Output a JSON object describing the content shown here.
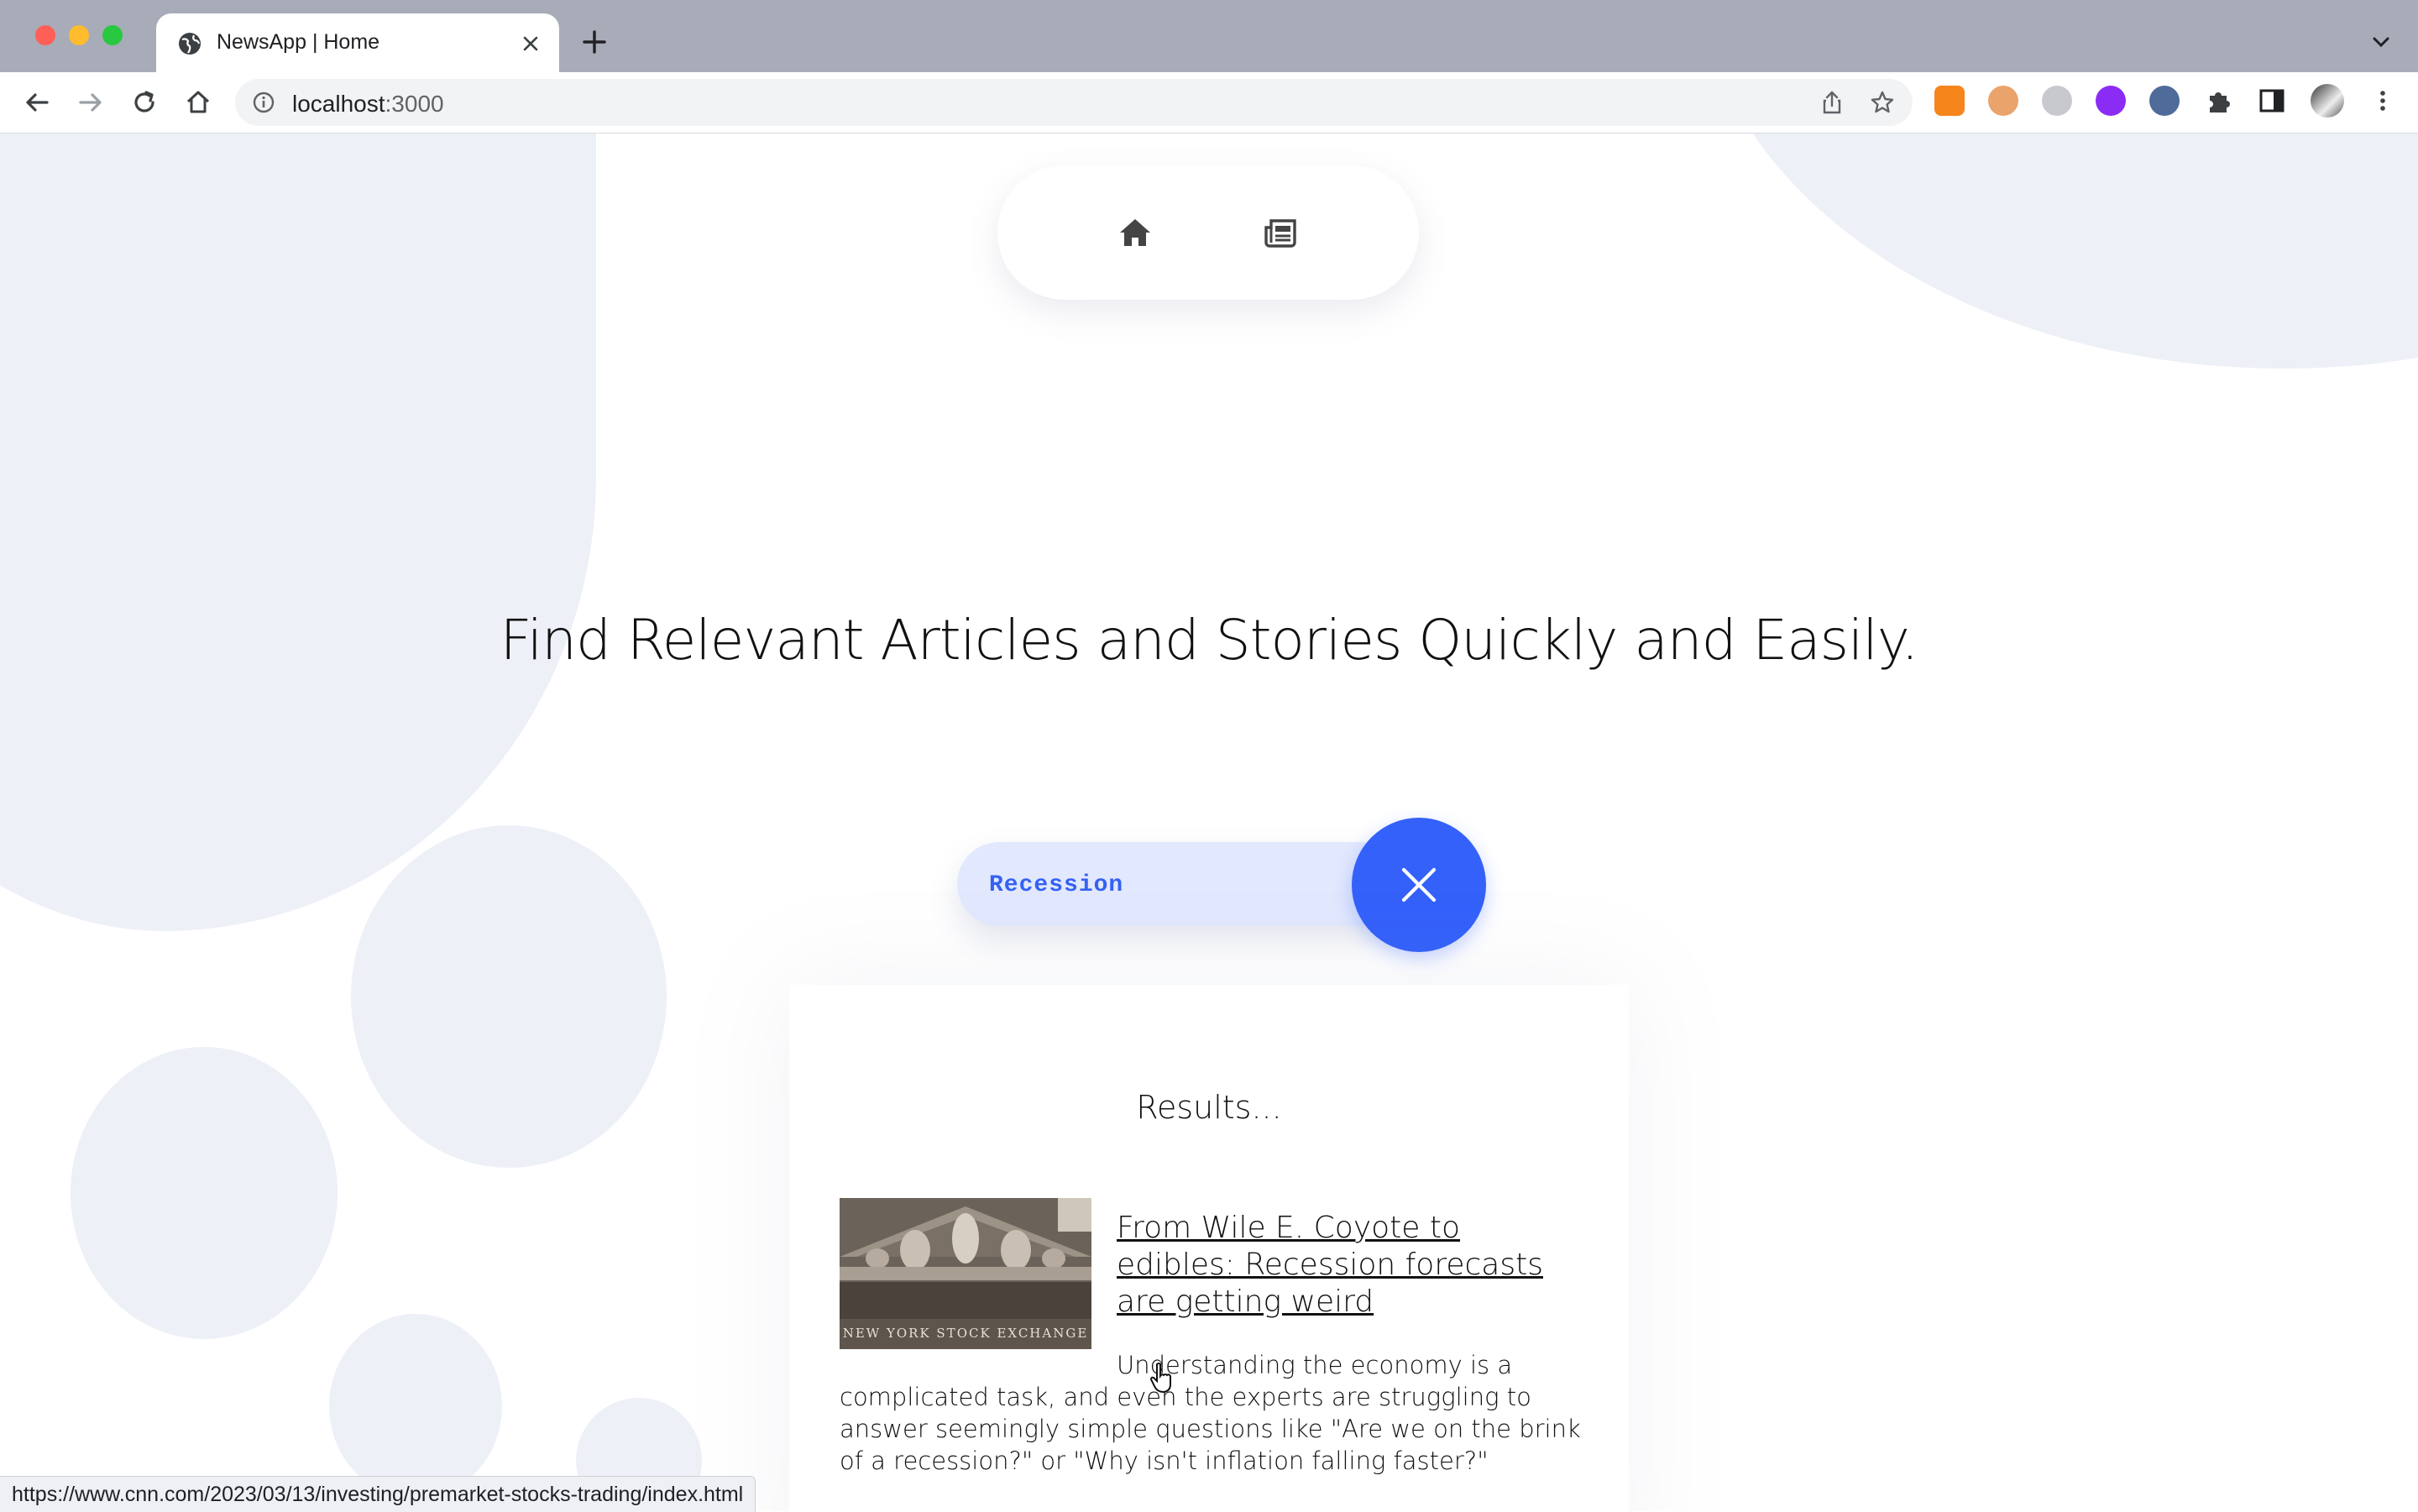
{
  "browser": {
    "tab_title": "NewsApp | Home",
    "url_host": "localhost",
    "url_port": ":3000",
    "status_url": "https://www.cnn.com/2023/03/13/investing/premarket-stocks-trading/index.html"
  },
  "nav": {
    "home_icon": "home-icon",
    "news_icon": "newspaper-icon"
  },
  "hero": {
    "headline": "Find Relevant Articles and Stories Quickly and Easily."
  },
  "search": {
    "value": "Recession",
    "clear_icon": "close-icon"
  },
  "results": {
    "title": "Results...",
    "articles": [
      {
        "title": "From Wile E. Coyote to edibles: Recession forecasts are getting weird",
        "description": "Understanding the economy is a complicated task, and even the experts are struggling to answer seemingly simple questions like \"Are we on the brink of a recession?\" or \"Why isn't inflation falling faster?\"",
        "thumbnail": "stock-exchange-facade-image",
        "thumbnail_caption": "NEW YORK STOCK EXCHANGE"
      }
    ]
  },
  "colors": {
    "accent": "#3461fa",
    "search_bg": "#e2e8fd",
    "blob": "#eef0f7",
    "tabbar": "#a8abb8"
  }
}
